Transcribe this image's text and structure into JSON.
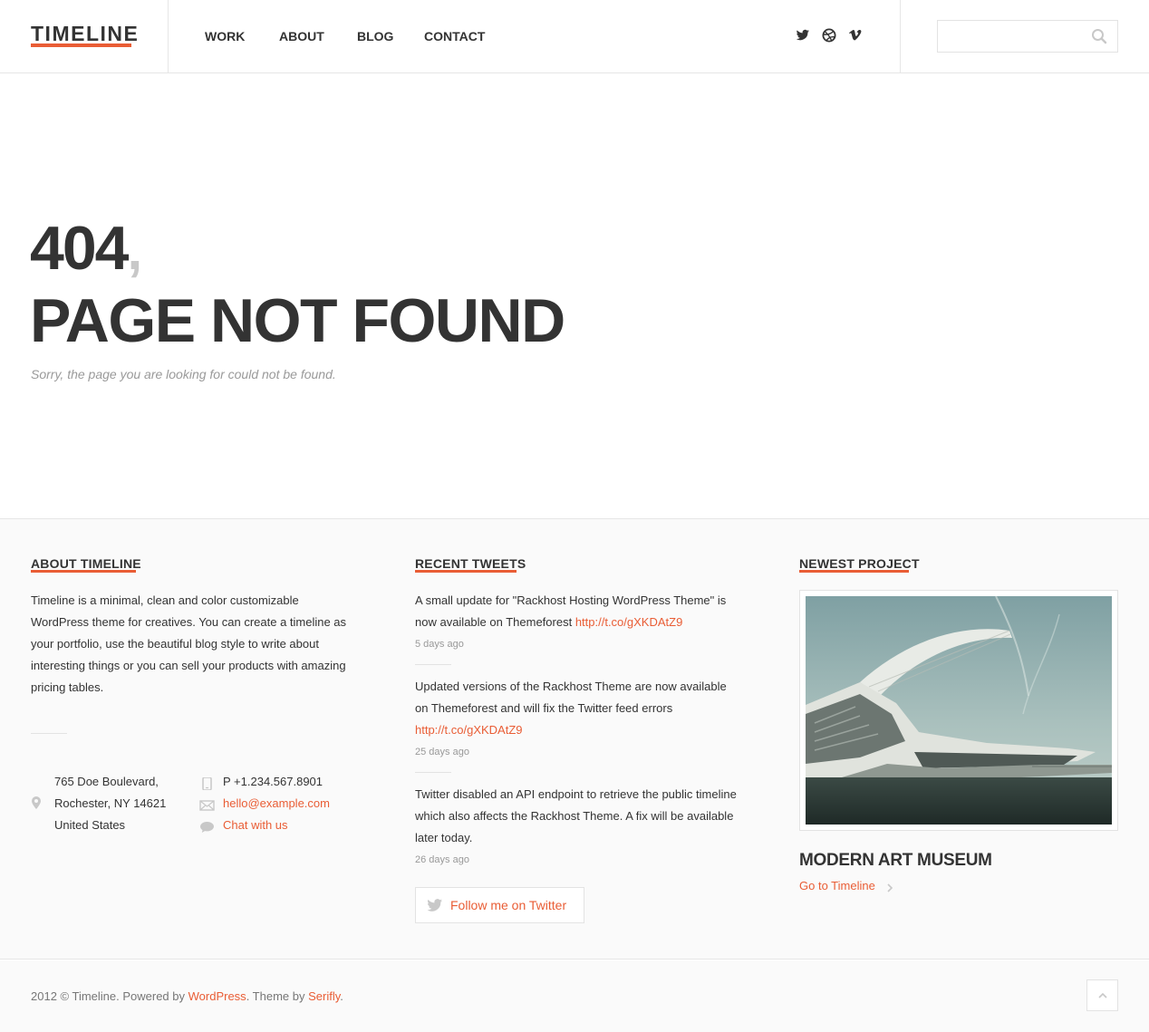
{
  "header": {
    "logo": "TIMELINE",
    "nav": [
      "WORK",
      "ABOUT",
      "BLOG",
      "CONTACT"
    ],
    "social": [
      "twitter-icon",
      "dribbble-icon",
      "vimeo-icon"
    ],
    "search": {
      "value": "",
      "placeholder": ""
    }
  },
  "hero": {
    "code": "404",
    "comma": ",",
    "title": "PAGE NOT FOUND",
    "subtitle": "Sorry, the page you are looking for could not be found."
  },
  "about": {
    "title": "ABOUT TIMELINE",
    "text": "Timeline is a minimal, clean and color customizable WordPress theme for creatives. You can create a timeline as your portfolio, use the beautiful blog style to write about interesting things or you can sell your products with amazing pricing tables.",
    "address": [
      "765 Doe Boulevard,",
      "Rochester, NY 14621",
      "United States"
    ],
    "phone": "P +1.234.567.8901",
    "email": "hello@example.com",
    "chat": "Chat with us"
  },
  "tweets": {
    "title": "RECENT TWEETS",
    "items": [
      {
        "text": "A small update for \"Rackhost Hosting WordPress Theme\" is now available on Themeforest ",
        "link": "http://t.co/gXKDAtZ9",
        "time": "5 days ago"
      },
      {
        "text": "Updated versions of the Rackhost Theme are now available on Themeforest and will fix the Twitter feed errors ",
        "link": "http://t.co/gXKDAtZ9",
        "time": "25 days ago"
      },
      {
        "text": "Twitter disabled an API endpoint to retrieve the public timeline which also affects the Rackhost Theme. A fix will be available later today.",
        "link": "",
        "time": "26 days ago"
      }
    ],
    "follow": "Follow me on Twitter"
  },
  "project": {
    "title": "NEWEST PROJECT",
    "name": "MODERN ART MUSEUM",
    "link": "Go to Timeline"
  },
  "footer": {
    "prefix": "2012 © Timeline. Powered by ",
    "wp": "WordPress",
    "mid": ". Theme by ",
    "author": "Serifly",
    "suffix": "."
  },
  "colors": {
    "accent": "#e95d35",
    "text": "#333333",
    "muted": "#999999",
    "bg_alt": "#fafafa"
  }
}
